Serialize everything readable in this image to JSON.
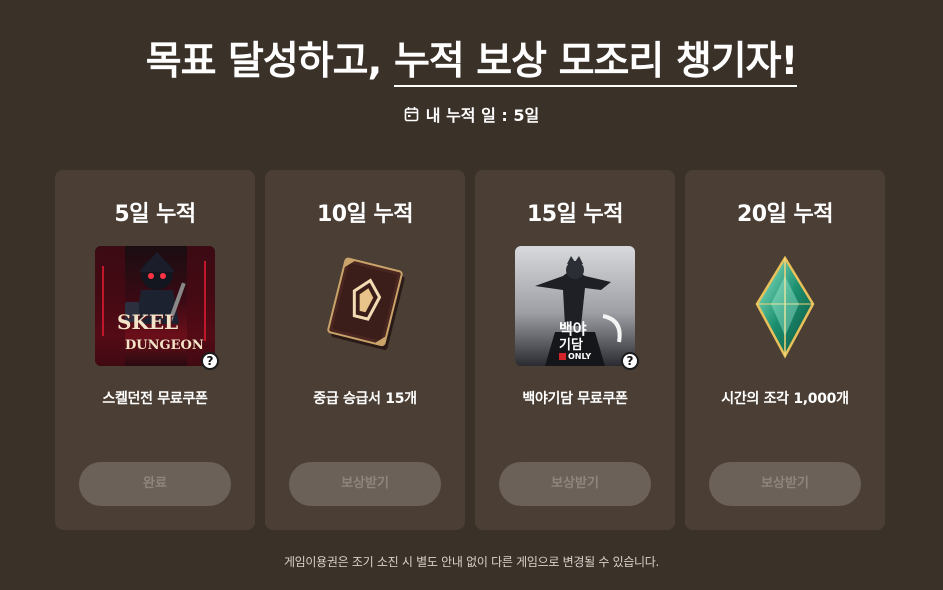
{
  "header": {
    "title_part1": "목표 달성하고, ",
    "title_part2": "누적 보상 모조리 챙기자!",
    "subtitle": "내 누적 일 : 5일",
    "calendar_icon": "calendar-icon"
  },
  "cards": [
    {
      "title": "5일 누적",
      "reward": "스켈던전 무료쿠폰",
      "button": "완료",
      "image": "skel-dungeon-cover",
      "image_text_1": "SKEL",
      "image_text_2": "DUNGEON",
      "has_help": true
    },
    {
      "title": "10일 누적",
      "reward": "중급 승급서 15개",
      "button": "보상받기",
      "image": "promotion-book-icon",
      "has_help": false
    },
    {
      "title": "15일 누적",
      "reward": "백야기담 무료쿠폰",
      "button": "보상받기",
      "image": "baekya-gidam-cover",
      "image_text_1": "백야",
      "image_text_2": "기담",
      "badge": "ONLY",
      "has_help": true
    },
    {
      "title": "20일 누적",
      "reward": "시간의 조각 1,000개",
      "button": "보상받기",
      "image": "time-fragment-crystal-icon",
      "has_help": false
    }
  ],
  "help_glyph": "?",
  "footer": {
    "notice": "게임이용권은 조기 소진 시 별도 안내 없이 다른 게임으로 변경될 수 있습니다."
  },
  "colors": {
    "background": "#3a3129",
    "card": "#4b3f35",
    "button_disabled": "#6b6159",
    "button_text": "#8f857c"
  }
}
